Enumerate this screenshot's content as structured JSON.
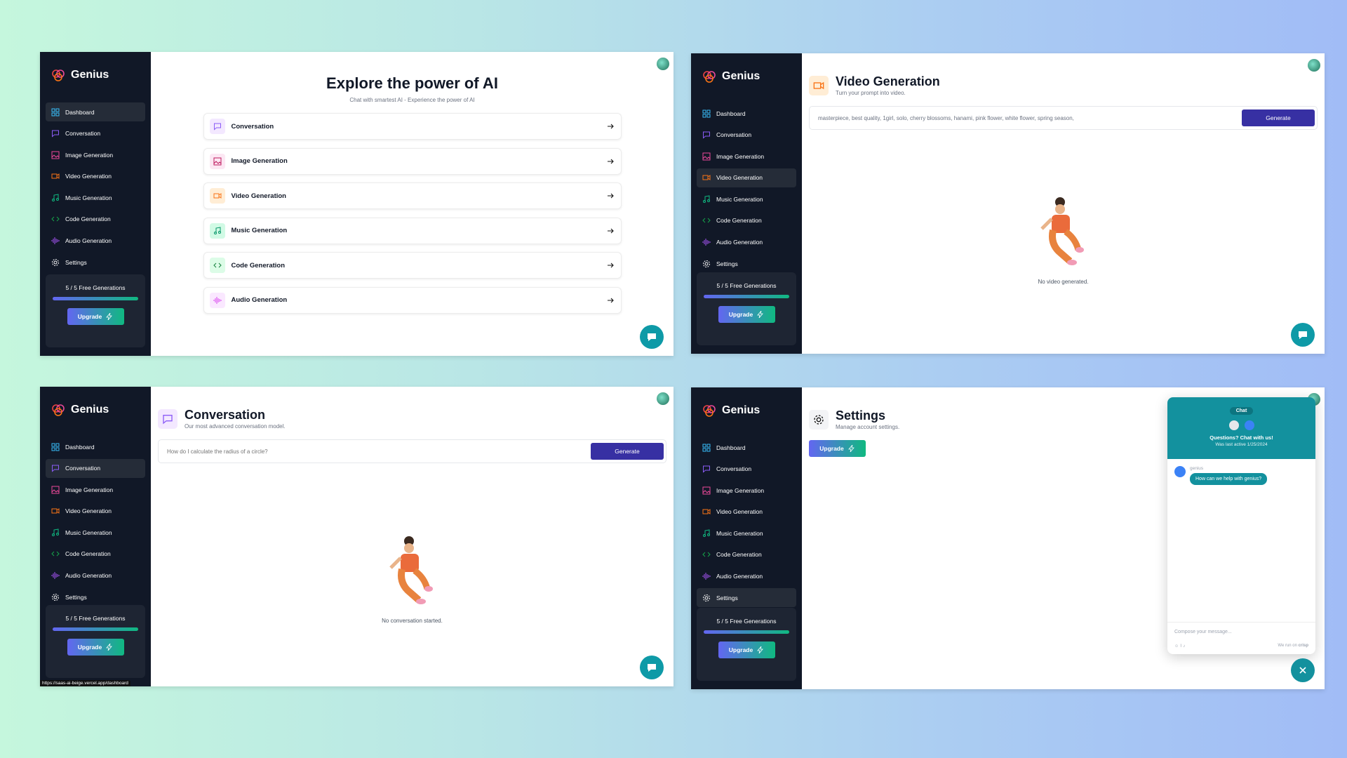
{
  "app": {
    "name": "Genius"
  },
  "nav": [
    {
      "label": "Dashboard",
      "icon": "dashboard-icon"
    },
    {
      "label": "Conversation",
      "icon": "message-icon"
    },
    {
      "label": "Image Generation",
      "icon": "image-icon"
    },
    {
      "label": "Video Generation",
      "icon": "video-icon"
    },
    {
      "label": "Music Generation",
      "icon": "music-icon"
    },
    {
      "label": "Code Generation",
      "icon": "code-icon"
    },
    {
      "label": "Audio Generation",
      "icon": "audio-icon"
    },
    {
      "label": "Settings",
      "icon": "gear-icon"
    }
  ],
  "credits": {
    "text": "5 / 5 Free Generations",
    "used": 5,
    "limit": 5,
    "upgrade_label": "Upgrade"
  },
  "dashboard": {
    "title": "Explore the power of AI",
    "subtitle": "Chat with smartest AI - Experience the power of AI",
    "tools": [
      {
        "label": "Conversation"
      },
      {
        "label": "Image Generation"
      },
      {
        "label": "Video Generation"
      },
      {
        "label": "Music Generation"
      },
      {
        "label": "Code Generation"
      },
      {
        "label": "Audio Generation"
      }
    ]
  },
  "video": {
    "title": "Video Generation",
    "subtitle": "Turn your prompt into video.",
    "prompt_value": "masterpiece, best quality, 1girl, solo, cherry blossoms, hanami, pink flower, white flower, spring season,",
    "button": "Generate",
    "empty": "No video generated."
  },
  "conversation": {
    "title": "Conversation",
    "subtitle": "Our most advanced conversation model.",
    "prompt_placeholder": "How do I calculate the radius of a circle?",
    "button": "Generate",
    "empty": "No conversation started.",
    "status_url": "https://saas-ai-beige.vercel.app/dashboard"
  },
  "settings": {
    "title": "Settings",
    "subtitle": "Manage account settings.",
    "upgrade_label": "Upgrade"
  },
  "chat_widget": {
    "tab": "Chat",
    "heading": "Questions? Chat with us!",
    "last_active": "Was last active 1/25/2024",
    "agent": "genius",
    "message": "How can we help with genius?",
    "compose_placeholder": "Compose your message...",
    "powered": "We run on",
    "brand": "crisp"
  },
  "colors": {
    "sidebar": "#111827",
    "accent": "#3730a3",
    "chat": "#13919e"
  }
}
